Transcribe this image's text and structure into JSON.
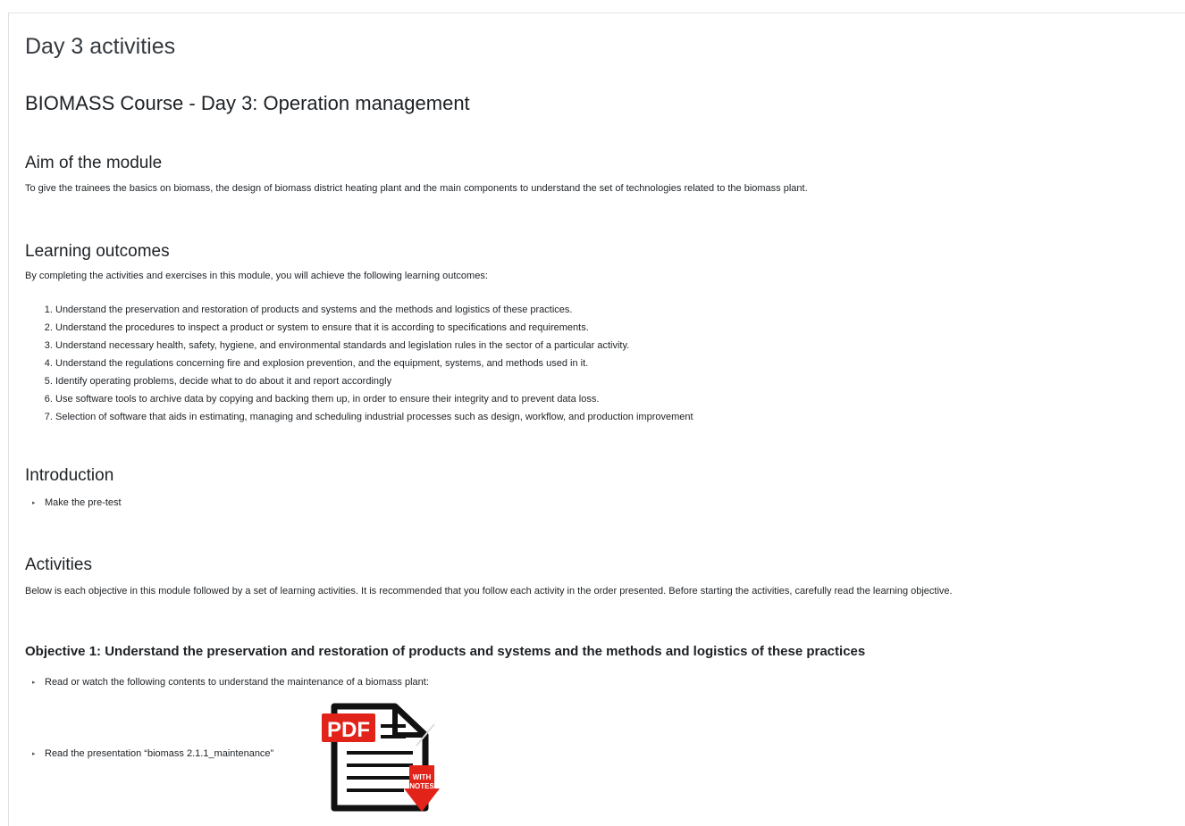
{
  "page_title": "Day 3 activities",
  "course_title": "BIOMASS Course - Day 3:  Operation management",
  "aim": {
    "heading": "Aim of the module",
    "text": "To give the trainees the basics on biomass, the design of biomass district heating plant and the main components to understand the set of technologies related to the biomass plant."
  },
  "learning_outcomes": {
    "heading": "Learning outcomes",
    "intro": "By completing the activities and exercises in this module, you will achieve the following learning outcomes:",
    "items": [
      "Understand the preservation and restoration of products and systems and the methods and logistics of these practices.",
      "Understand the procedures to inspect a product or system to ensure that it is according to specifications and requirements.",
      "Understand necessary health, safety, hygiene, and environmental standards and legislation rules in the sector of a particular activity.",
      "Understand the regulations concerning fire and explosion prevention, and the equipment, systems, and methods used in it.",
      "Identify operating problems, decide what to do about it and report accordingly",
      "Use software tools to archive data by copying and backing them up, in order to ensure their integrity and to prevent data loss.",
      "Selection of software that aids in estimating, managing and scheduling industrial processes such as design, workflow, and production improvement"
    ]
  },
  "introduction": {
    "heading": "Introduction",
    "items": [
      "Make the pre-test"
    ]
  },
  "activities": {
    "heading": "Activities",
    "text": "Below is each objective in this module followed by a set of learning activities. It is recommended that you follow each activity in the order presented. Before starting the activities, carefully read the learning objective."
  },
  "objective1": {
    "heading": "Objective 1: Understand the preservation and restoration of products and systems and the methods and logistics of these practices",
    "item_read_watch": "Read or watch the following contents to understand the maintenance of a biomass plant:",
    "item_presentation": "Read the presentation “biomass 2.1.1_maintenance”",
    "pdf_icon": {
      "name": "pdf-with-notes-icon",
      "badge": "PDF",
      "ribbon_line1": "WITH",
      "ribbon_line2": "NOTES",
      "badge_color": "#e2231a",
      "outline_color": "#111111"
    }
  }
}
